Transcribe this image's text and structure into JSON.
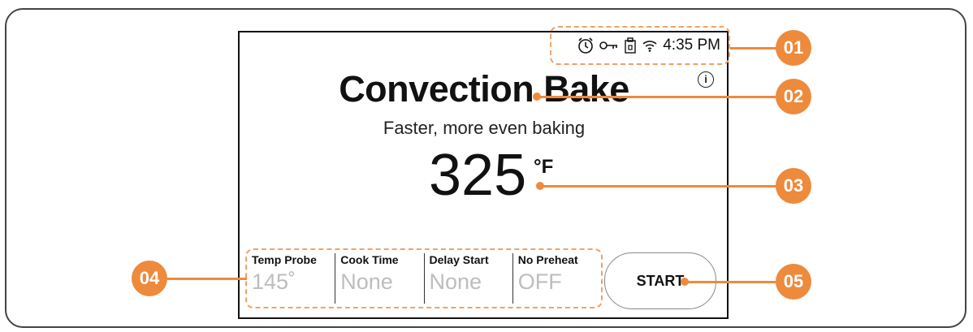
{
  "status": {
    "time": "4:35 PM",
    "icons": [
      "alarm-icon",
      "key-lock-icon",
      "lock-icon",
      "wifi-icon"
    ]
  },
  "mode": {
    "title": "Convection Bake",
    "subtitle": "Faster, more even baking"
  },
  "temperature": {
    "value": "325",
    "unit": "°F"
  },
  "options": [
    {
      "label": "Temp Probe",
      "value": "145˚"
    },
    {
      "label": "Cook Time",
      "value": "None"
    },
    {
      "label": "Delay Start",
      "value": "None"
    },
    {
      "label": "No Preheat",
      "value": "OFF"
    }
  ],
  "start_label": "START",
  "callouts": [
    "01",
    "02",
    "03",
    "04",
    "05"
  ],
  "colors": {
    "accent": "#ee8a3c",
    "accent_dashed": "#f0a168"
  }
}
